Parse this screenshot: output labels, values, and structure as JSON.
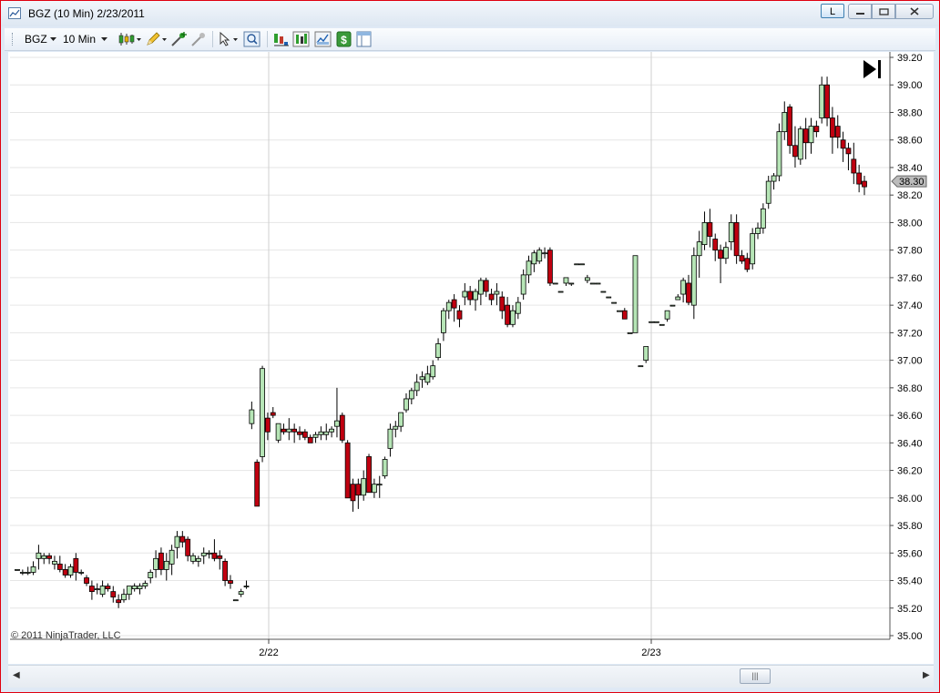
{
  "window": {
    "title": "BGZ (10 Min)  2/23/2011",
    "link_button_label": "L",
    "colors": {
      "border": "#e0000f",
      "up_candle": "#b6e5b6",
      "down_candle": "#c00010",
      "price_marker": "#bcbcbc"
    }
  },
  "toolbar": {
    "instrument": "BGZ",
    "interval": "10 Min",
    "icons": [
      "candlestick-style-icon",
      "draw-pencil-icon",
      "add-indicator-icon",
      "remove-indicator-icon",
      "pointer-icon",
      "zoom-icon",
      "chart-bars-icon",
      "chart-data-icon",
      "chart-properties-icon",
      "dollar-icon",
      "panel-icon"
    ]
  },
  "chart": {
    "copyright": "© 2011 NinjaTrader, LLC",
    "last_price": "38.30",
    "go_to_end_glyph": "▶|"
  },
  "chart_data": {
    "type": "candlestick",
    "y_range": [
      35.0,
      39.2
    ],
    "y_ticks": [
      "39.20",
      "39.00",
      "38.80",
      "38.60",
      "38.40",
      "38.20",
      "38.00",
      "37.80",
      "37.60",
      "37.40",
      "37.20",
      "37.00",
      "36.80",
      "36.60",
      "36.40",
      "36.20",
      "36.00",
      "35.80",
      "35.60",
      "35.40",
      "35.20",
      "35.00"
    ],
    "x_labels": [
      "2/22",
      "2/23"
    ],
    "grid": true,
    "candles": [
      [
        35.48,
        35.48,
        35.48,
        35.48
      ],
      [
        35.46,
        35.48,
        35.44,
        35.46
      ],
      [
        35.46,
        35.5,
        35.44,
        35.46
      ],
      [
        35.46,
        35.54,
        35.44,
        35.5
      ],
      [
        35.56,
        35.66,
        35.48,
        35.6
      ],
      [
        35.56,
        35.6,
        35.52,
        35.58
      ],
      [
        35.58,
        35.6,
        35.52,
        35.56
      ],
      [
        35.52,
        35.58,
        35.48,
        35.54
      ],
      [
        35.52,
        35.58,
        35.46,
        35.48
      ],
      [
        35.48,
        35.52,
        35.42,
        35.44
      ],
      [
        35.44,
        35.52,
        35.42,
        35.5
      ],
      [
        35.56,
        35.6,
        35.4,
        35.46
      ],
      [
        35.46,
        35.48,
        35.44,
        35.46
      ],
      [
        35.42,
        35.44,
        35.36,
        35.38
      ],
      [
        35.36,
        35.4,
        35.26,
        35.32
      ],
      [
        35.34,
        35.38,
        35.3,
        35.34
      ],
      [
        35.3,
        35.4,
        35.28,
        35.36
      ],
      [
        35.36,
        35.38,
        35.32,
        35.34
      ],
      [
        35.32,
        35.36,
        35.24,
        35.28
      ],
      [
        35.26,
        35.3,
        35.2,
        35.24
      ],
      [
        35.26,
        35.34,
        35.24,
        35.3
      ],
      [
        35.3,
        35.34,
        35.26,
        35.36
      ],
      [
        35.34,
        35.38,
        35.32,
        35.36
      ],
      [
        35.34,
        35.38,
        35.3,
        35.36
      ],
      [
        35.36,
        35.4,
        35.34,
        35.38
      ],
      [
        35.42,
        35.48,
        35.38,
        35.46
      ],
      [
        35.48,
        35.62,
        35.42,
        35.56
      ],
      [
        35.6,
        35.64,
        35.44,
        35.48
      ],
      [
        35.48,
        35.6,
        35.4,
        35.54
      ],
      [
        35.52,
        35.66,
        35.44,
        35.62
      ],
      [
        35.64,
        35.76,
        35.56,
        35.72
      ],
      [
        35.72,
        35.76,
        35.64,
        35.68
      ],
      [
        35.7,
        35.72,
        35.54,
        35.58
      ],
      [
        35.54,
        35.6,
        35.52,
        35.58
      ],
      [
        35.54,
        35.58,
        35.5,
        35.56
      ],
      [
        35.58,
        35.64,
        35.52,
        35.6
      ],
      [
        35.6,
        35.62,
        35.56,
        35.6
      ],
      [
        35.6,
        35.7,
        35.54,
        35.56
      ],
      [
        35.58,
        35.62,
        35.48,
        35.56
      ],
      [
        35.54,
        35.56,
        35.36,
        35.4
      ],
      [
        35.4,
        35.44,
        35.34,
        35.38
      ],
      [
        35.26,
        35.26,
        35.26,
        35.26
      ],
      [
        35.3,
        35.34,
        35.28,
        35.32
      ],
      [
        35.36,
        35.4,
        35.34,
        35.36
      ],
      [
        36.54,
        36.7,
        36.5,
        36.64
      ],
      [
        36.26,
        36.28,
        35.94,
        35.94
      ],
      [
        36.3,
        36.96,
        36.26,
        36.94
      ],
      [
        36.58,
        36.62,
        36.42,
        36.48
      ],
      [
        36.62,
        36.66,
        36.58,
        36.6
      ],
      [
        36.42,
        36.54,
        36.4,
        36.54
      ],
      [
        36.5,
        36.54,
        36.46,
        36.48
      ],
      [
        36.48,
        36.58,
        36.42,
        36.5
      ],
      [
        36.5,
        36.54,
        36.4,
        36.48
      ],
      [
        36.48,
        36.52,
        36.42,
        36.46
      ],
      [
        36.48,
        36.5,
        36.42,
        36.44
      ],
      [
        36.44,
        36.46,
        36.4,
        36.4
      ],
      [
        36.44,
        36.48,
        36.4,
        36.46
      ],
      [
        36.46,
        36.52,
        36.42,
        36.48
      ],
      [
        36.46,
        36.54,
        36.42,
        36.48
      ],
      [
        36.48,
        36.52,
        36.44,
        36.5
      ],
      [
        36.52,
        36.8,
        36.44,
        36.56
      ],
      [
        36.6,
        36.62,
        36.4,
        36.42
      ],
      [
        36.4,
        36.42,
        36.0,
        36.0
      ],
      [
        36.1,
        36.14,
        35.9,
        35.98
      ],
      [
        36.1,
        36.14,
        35.92,
        36.02
      ],
      [
        36.02,
        36.2,
        35.98,
        36.14
      ],
      [
        36.3,
        36.32,
        36.06,
        36.04
      ],
      [
        36.04,
        36.14,
        36.0,
        36.1
      ],
      [
        36.1,
        36.16,
        36.0,
        36.1
      ],
      [
        36.16,
        36.3,
        36.14,
        36.28
      ],
      [
        36.36,
        36.54,
        36.3,
        36.5
      ],
      [
        36.5,
        36.56,
        36.44,
        36.52
      ],
      [
        36.52,
        36.62,
        36.48,
        36.62
      ],
      [
        36.64,
        36.76,
        36.62,
        36.72
      ],
      [
        36.72,
        36.8,
        36.68,
        36.78
      ],
      [
        36.78,
        36.9,
        36.74,
        36.84
      ],
      [
        36.86,
        36.92,
        36.8,
        36.88
      ],
      [
        36.84,
        36.96,
        36.82,
        36.9
      ],
      [
        36.88,
        37.0,
        36.86,
        36.96
      ],
      [
        37.02,
        37.16,
        37.0,
        37.12
      ],
      [
        37.2,
        37.38,
        37.14,
        37.36
      ],
      [
        37.36,
        37.44,
        37.3,
        37.42
      ],
      [
        37.44,
        37.48,
        37.28,
        37.38
      ],
      [
        37.36,
        37.4,
        37.24,
        37.3
      ],
      [
        37.46,
        37.56,
        37.4,
        37.5
      ],
      [
        37.5,
        37.54,
        37.4,
        37.44
      ],
      [
        37.44,
        37.52,
        37.36,
        37.5
      ],
      [
        37.48,
        37.6,
        37.4,
        37.58
      ],
      [
        37.58,
        37.6,
        37.46,
        37.5
      ],
      [
        37.48,
        37.52,
        37.4,
        37.44
      ],
      [
        37.48,
        37.56,
        37.4,
        37.5
      ],
      [
        37.46,
        37.5,
        37.3,
        37.36
      ],
      [
        37.4,
        37.46,
        37.24,
        37.26
      ],
      [
        37.26,
        37.4,
        37.24,
        37.36
      ],
      [
        37.34,
        37.46,
        37.3,
        37.42
      ],
      [
        37.48,
        37.66,
        37.44,
        37.62
      ],
      [
        37.62,
        37.76,
        37.56,
        37.72
      ],
      [
        37.7,
        37.8,
        37.64,
        37.78
      ],
      [
        37.72,
        37.82,
        37.7,
        37.8
      ],
      [
        37.78,
        37.82,
        37.74,
        37.78
      ],
      [
        37.8,
        37.82,
        37.54,
        37.56
      ],
      [
        37.56,
        37.56,
        37.56,
        37.56
      ],
      [
        37.5,
        37.5,
        37.5,
        37.5
      ],
      [
        37.56,
        37.6,
        37.54,
        37.6
      ],
      [
        37.56,
        37.56,
        37.54,
        37.56
      ],
      [
        37.7,
        37.7,
        37.7,
        37.7
      ],
      [
        37.7,
        37.7,
        37.7,
        37.7
      ],
      [
        37.58,
        37.62,
        37.56,
        37.6
      ],
      [
        37.56,
        37.56,
        37.56,
        37.56
      ],
      [
        37.56,
        37.56,
        37.56,
        37.56
      ],
      [
        37.5,
        37.5,
        37.5,
        37.5
      ],
      [
        37.46,
        37.46,
        37.46,
        37.46
      ],
      [
        37.42,
        37.42,
        37.42,
        37.42
      ],
      [
        37.36,
        37.36,
        37.36,
        37.36
      ],
      [
        37.36,
        37.38,
        37.3,
        37.3
      ],
      [
        37.2,
        37.2,
        37.2,
        37.2
      ],
      [
        37.2,
        37.76,
        37.2,
        37.76
      ],
      [
        36.96,
        36.96,
        36.96,
        36.96
      ],
      [
        37.0,
        37.1,
        36.98,
        37.1
      ],
      [
        37.28,
        37.28,
        37.28,
        37.28
      ],
      [
        37.28,
        37.28,
        37.28,
        37.28
      ],
      [
        37.26,
        37.26,
        37.26,
        37.26
      ],
      [
        37.3,
        37.36,
        37.28,
        37.36
      ],
      [
        37.4,
        37.4,
        37.4,
        37.4
      ],
      [
        37.44,
        37.48,
        37.44,
        37.46
      ],
      [
        37.48,
        37.6,
        37.42,
        37.58
      ],
      [
        37.56,
        37.62,
        37.4,
        37.42
      ],
      [
        37.4,
        37.82,
        37.3,
        37.76
      ],
      [
        37.76,
        37.94,
        37.6,
        37.86
      ],
      [
        37.84,
        38.08,
        37.8,
        38.0
      ],
      [
        38.0,
        38.1,
        37.82,
        37.9
      ],
      [
        37.88,
        37.92,
        37.72,
        37.8
      ],
      [
        37.8,
        37.84,
        37.56,
        37.74
      ],
      [
        37.74,
        37.86,
        37.7,
        37.82
      ],
      [
        37.86,
        38.06,
        37.8,
        38.0
      ],
      [
        38.0,
        38.06,
        37.7,
        37.76
      ],
      [
        37.76,
        37.8,
        37.7,
        37.72
      ],
      [
        37.74,
        37.78,
        37.64,
        37.66
      ],
      [
        37.7,
        37.96,
        37.66,
        37.92
      ],
      [
        37.92,
        38.0,
        37.88,
        37.96
      ],
      [
        37.96,
        38.14,
        37.92,
        38.1
      ],
      [
        38.14,
        38.34,
        38.1,
        38.3
      ],
      [
        38.3,
        38.36,
        38.24,
        38.34
      ],
      [
        38.34,
        38.72,
        38.3,
        38.66
      ],
      [
        38.66,
        38.88,
        38.6,
        38.8
      ],
      [
        38.84,
        38.86,
        38.5,
        38.56
      ],
      [
        38.56,
        38.7,
        38.4,
        38.48
      ],
      [
        38.46,
        38.7,
        38.42,
        38.68
      ],
      [
        38.68,
        38.76,
        38.46,
        38.58
      ],
      [
        38.58,
        38.76,
        38.5,
        38.7
      ],
      [
        38.7,
        38.74,
        38.62,
        38.66
      ],
      [
        38.76,
        39.06,
        38.72,
        39.0
      ],
      [
        39.0,
        39.06,
        38.7,
        38.76
      ],
      [
        38.76,
        38.84,
        38.5,
        38.62
      ],
      [
        38.7,
        38.78,
        38.54,
        38.62
      ],
      [
        38.6,
        38.66,
        38.44,
        38.54
      ],
      [
        38.54,
        38.58,
        38.38,
        38.5
      ],
      [
        38.46,
        38.58,
        38.28,
        38.36
      ],
      [
        38.36,
        38.42,
        38.22,
        38.28
      ],
      [
        38.3,
        38.34,
        38.2,
        38.26
      ]
    ]
  },
  "scrollbar": {
    "thumb_glyph": "|||"
  }
}
